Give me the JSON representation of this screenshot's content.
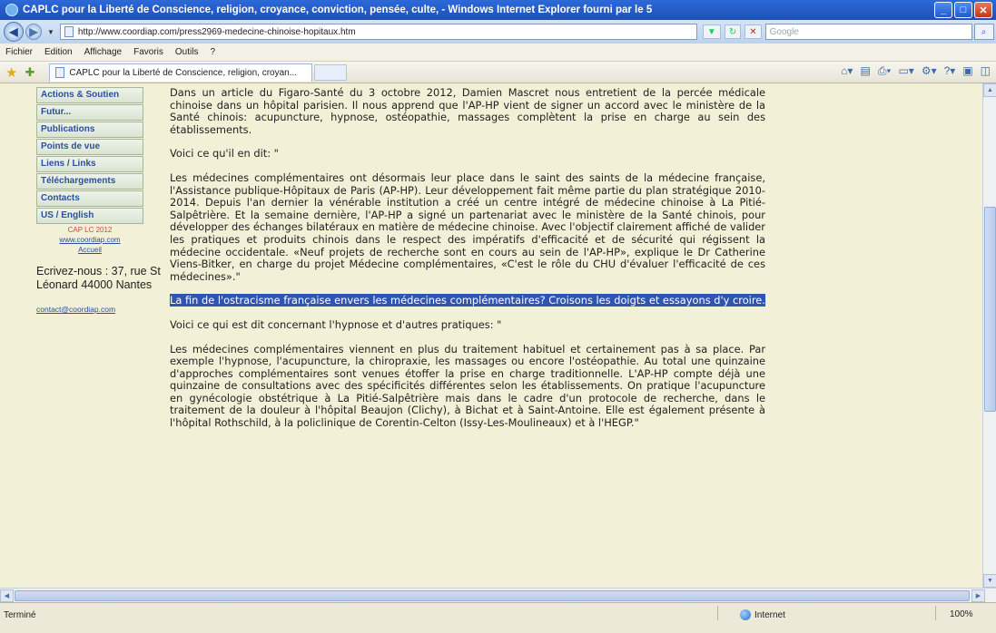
{
  "window": {
    "title": "CAPLC pour la Liberté de Conscience, religion, croyance, conviction, pensée, culte, - Windows Internet Explorer fourni par le 5"
  },
  "address_bar": {
    "url": "http://www.coordiap.com/press2969-medecine-chinoise-hopitaux.htm",
    "search_placeholder": "Google"
  },
  "menu": [
    "Fichier",
    "Edition",
    "Affichage",
    "Favoris",
    "Outils",
    "?"
  ],
  "tab": {
    "title": "CAPLC pour la Liberté de Conscience, religion, croyan..."
  },
  "sidebar": {
    "items": [
      {
        "label": "Actions & Soutien"
      },
      {
        "label": "Futur..."
      },
      {
        "label": "Publications"
      },
      {
        "label": "Points de vue"
      },
      {
        "label": "Liens / Links"
      },
      {
        "label": "Téléchargements"
      },
      {
        "label": "Contacts"
      },
      {
        "label": "US / English"
      }
    ],
    "copyright": "CAP LC 2012",
    "site_link": "www.coordiap.com",
    "home_link": "Accueil",
    "address": "Ecrivez-nous : 37, rue St Léonard 44000 Nantes",
    "contact_email": "contact@coordiap.com"
  },
  "article": {
    "paragraphs": [
      "Dans un article du Figaro-Santé du 3 octobre 2012, Damien Mascret nous entretient de la percée médicale chinoise dans un hôpital parisien. Il nous apprend que l'AP-HP vient de signer un accord avec le ministère de la Santé chinois: acupuncture, hypnose, ostéopathie, massages complètent la prise en charge au sein des établissements.",
      "Voici ce qu'il en dit: \"",
      "Les médecines complémentaires ont désormais leur place dans le saint des saints de la médecine française, l'Assistance publique-Hôpitaux de Paris (AP-HP). Leur développement fait même partie du plan stratégique 2010-2014. Depuis l'an dernier la vénérable institution a créé un centre intégré de médecine chinoise à La Pitié-Salpêtrière. Et la semaine dernière, l'AP-HP a signé un partenariat avec le ministère de la Santé chinois, pour développer des échanges bilatéraux en matière de médecine chinoise. Avec l'objectif clairement affiché de valider les pratiques et produits chinois dans le respect des impératifs d'efficacité et de sécurité qui régissent la médecine occidentale. «Neuf projets de recherche sont en cours au sein de l'AP-HP», explique le Dr Catherine Viens-Bitker, en charge du projet Médecine complémentaires, «C'est le rôle du CHU d'évaluer l'efficacité de ces médecines».\"",
      "La fin de l'ostracisme française envers les médecines complémentaires? Croisons les doigts et essayons d'y croire.",
      "Voici ce qui est dit concernant l'hypnose et d'autres pratiques: \"",
      "Les médecines complémentaires viennent en plus du traitement habituel et certainement pas à sa place. Par exemple l'hypnose, l'acupuncture, la chiropraxie, les massages ou encore l'ostéopathie. Au total une quinzaine d'approches complémentaires sont venues étoffer la prise en charge traditionnelle. L'AP-HP compte déjà une quinzaine de consultations avec des spécificités différentes selon les établissements. On pratique l'acupuncture en gynécologie obstétrique à La Pitié-Salpêtrière mais dans le cadre d'un protocole de recherche, dans le traitement de la douleur à l'hôpital Beaujon (Clichy), à Bichat et à Saint-Antoine. Elle est également présente à l'hôpital Rothschild, à la policlinique de Corentin-Celton (Issy-Les-Moulineaux) et à l'HEGP.\""
    ]
  },
  "status": {
    "text": "Terminé",
    "zone": "Internet",
    "zoom": "100%"
  }
}
